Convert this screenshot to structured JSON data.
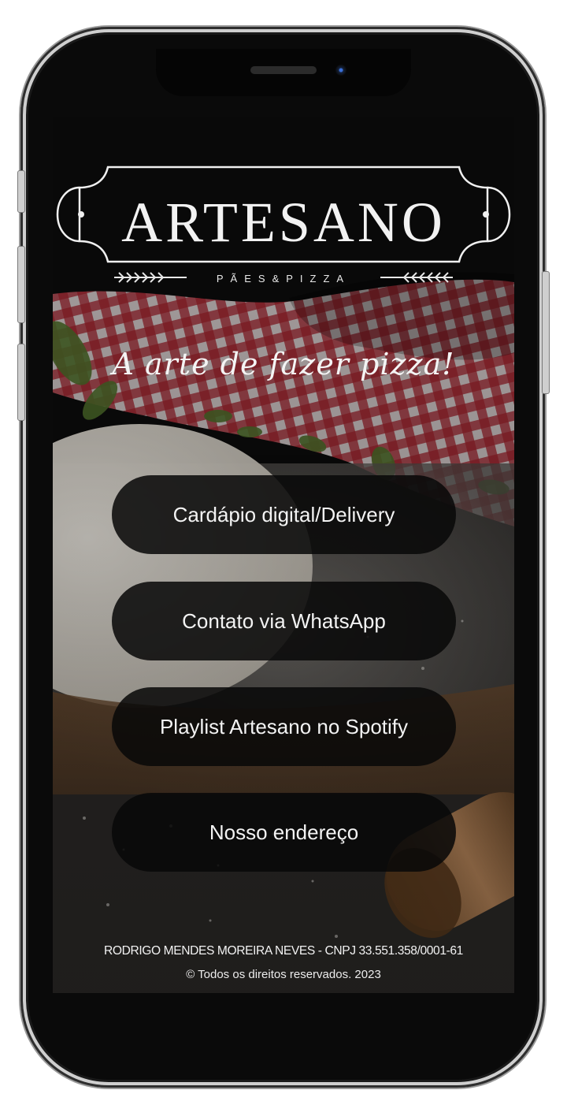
{
  "brand": {
    "name": "ARTESANO",
    "subtitle": "PÃES&PIZZA",
    "tagline": "A arte de fazer pizza!"
  },
  "menu": {
    "items": [
      {
        "label": "Cardápio digital/Delivery"
      },
      {
        "label": "Contato via WhatsApp"
      },
      {
        "label": "Playlist Artesano no Spotify"
      },
      {
        "label": "Nosso endereço"
      }
    ]
  },
  "footer": {
    "company": "RODRIGO MENDES MOREIRA NEVES - CNPJ 33.551.358/0001-61",
    "copyright": "© Todos os direitos reservados. 2023"
  },
  "colors": {
    "button_bg": "#080808",
    "text": "#f3f3f3",
    "checkered_red": "#b2222e"
  }
}
